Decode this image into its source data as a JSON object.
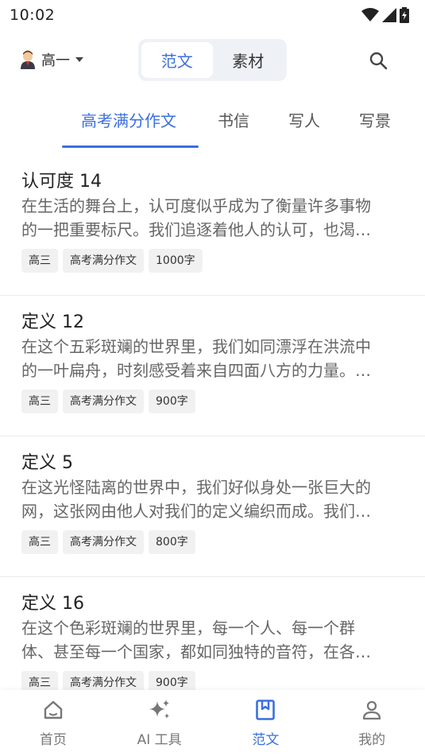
{
  "status": {
    "time": "10:02"
  },
  "header": {
    "grade": "高一",
    "segments": [
      "范文",
      "素材"
    ]
  },
  "categories": [
    "高考满分作文",
    "书信",
    "写人",
    "写景"
  ],
  "articles": [
    {
      "title": "认可度 14",
      "excerpt1": "在生活的舞台上，认可度似乎成为了衡量许多事物",
      "excerpt2": "的一把重要标尺。我们追逐着他人的认可，也渴…",
      "tags": [
        "高三",
        "高考满分作文",
        "1000字"
      ]
    },
    {
      "title": "定义 12",
      "excerpt1": "在这个五彩斑斓的世界里，我们如同漂浮在洪流中",
      "excerpt2": "的一叶扁舟，时刻感受着来自四面八方的力量。…",
      "tags": [
        "高三",
        "高考满分作文",
        "900字"
      ]
    },
    {
      "title": "定义 5",
      "excerpt1": "在这光怪陆离的世界中，我们好似身处一张巨大的",
      "excerpt2": "网，这张网由他人对我们的定义编织而成。我们…",
      "tags": [
        "高三",
        "高考满分作文",
        "800字"
      ]
    },
    {
      "title": "定义 16",
      "excerpt1": "在这个色彩斑斓的世界里，每一个人、每一个群",
      "excerpt2": "体、甚至每一个国家，都如同独特的音符，在各…",
      "tags": [
        "高三",
        "高考满分作文",
        "900字"
      ]
    }
  ],
  "nav": [
    {
      "label": "首页",
      "icon": "home-icon"
    },
    {
      "label": "AI 工具",
      "icon": "sparkle-icon"
    },
    {
      "label": "范文",
      "icon": "bookmark-book-icon"
    },
    {
      "label": "我的",
      "icon": "profile-icon"
    }
  ],
  "colors": {
    "accent": "#3b6fe0",
    "text": "#222222",
    "muted": "#666666",
    "tag_bg": "#f1f1f1",
    "segment_bg": "#eef1f5"
  }
}
